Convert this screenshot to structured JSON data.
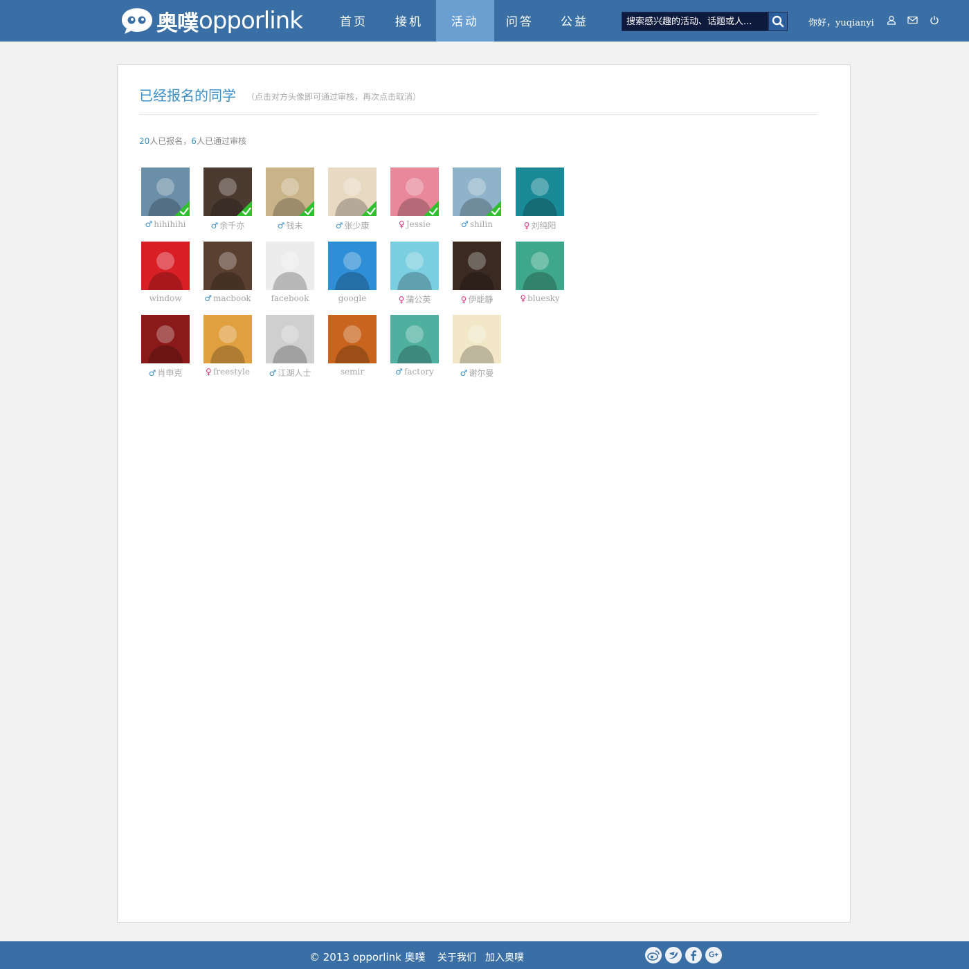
{
  "header": {
    "logo_cn": "奥噗",
    "logo_en": "opporlink",
    "nav": [
      {
        "label": "首页"
      },
      {
        "label": "接机"
      },
      {
        "label": "活动"
      },
      {
        "label": "问答"
      },
      {
        "label": "公益"
      }
    ],
    "active_nav": "活动",
    "search_placeholder": "搜索感兴趣的活动、话题或人...",
    "greeting": "你好，yuqianyi",
    "icons": [
      "user-icon",
      "mail-icon",
      "power-icon"
    ]
  },
  "panel": {
    "title": "已经报名的同学",
    "hint": "（点击对方头像即可通过审核，再次点击取消）",
    "summary": {
      "registered": "20",
      "registered_text": "人已报名，",
      "approved": "6",
      "approved_text": "人已通过审核"
    }
  },
  "members": [
    {
      "name": "hihihihi",
      "gender": "male",
      "approved": true,
      "color": "#6b8fa8"
    },
    {
      "name": "余千亦",
      "gender": "male",
      "approved": true,
      "color": "#4a3a30"
    },
    {
      "name": "钱未",
      "gender": "male",
      "approved": true,
      "color": "#c9b48a"
    },
    {
      "name": "张少康",
      "gender": "male",
      "approved": true,
      "color": "#e8d9c2"
    },
    {
      "name": "Jessie",
      "gender": "female",
      "approved": true,
      "color": "#e8889a"
    },
    {
      "name": "shilin",
      "gender": "male",
      "approved": true,
      "color": "#8fb3c8"
    },
    {
      "name": "刘纯阳",
      "gender": "female",
      "approved": false,
      "color": "#1a8a96"
    },
    {
      "name": "window",
      "gender": "none",
      "approved": false,
      "color": "#d81f26"
    },
    {
      "name": "macbook",
      "gender": "male",
      "approved": false,
      "color": "#5a4030"
    },
    {
      "name": "facebook",
      "gender": "none",
      "approved": false,
      "color": "#ececec"
    },
    {
      "name": "google",
      "gender": "none",
      "approved": false,
      "color": "#2f8fd6"
    },
    {
      "name": "蒲公英",
      "gender": "female",
      "approved": false,
      "color": "#7ccfe0"
    },
    {
      "name": "伊能静",
      "gender": "female",
      "approved": false,
      "color": "#3a2a22"
    },
    {
      "name": "bluesky",
      "gender": "female",
      "approved": false,
      "color": "#3fa88a"
    },
    {
      "name": "肖申克",
      "gender": "male",
      "approved": false,
      "color": "#8a1a1a"
    },
    {
      "name": "freestyle",
      "gender": "female",
      "approved": false,
      "color": "#e0a040"
    },
    {
      "name": "江湖人士",
      "gender": "male",
      "approved": false,
      "color": "#cfcfcf"
    },
    {
      "name": "semir",
      "gender": "none",
      "approved": false,
      "color": "#c8641e"
    },
    {
      "name": "factory",
      "gender": "male",
      "approved": false,
      "color": "#4fb0a0"
    },
    {
      "name": "谢尔曼",
      "gender": "male",
      "approved": false,
      "color": "#f2e8c8"
    }
  ],
  "footer": {
    "copyright": "© 2013  opporlink  奥噗",
    "links": [
      "关于我们",
      "加入奥噗"
    ],
    "social": [
      "weibo-icon",
      "twitter-icon",
      "facebook-icon",
      "google-plus-icon"
    ]
  }
}
